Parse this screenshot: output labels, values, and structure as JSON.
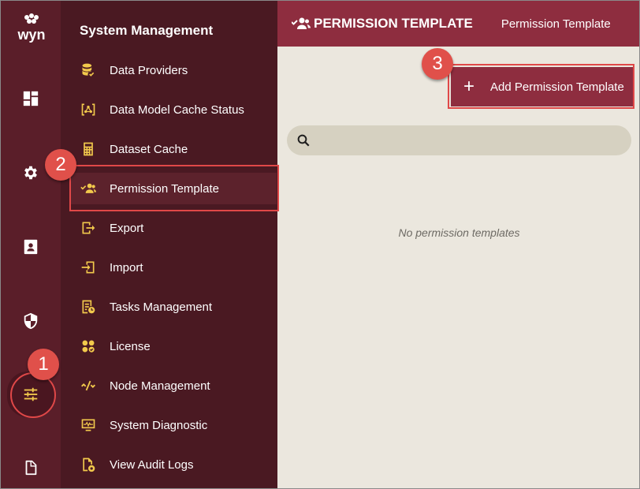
{
  "app": {
    "logo_text": "wyn"
  },
  "rail": {
    "items": [
      {
        "name": "dashboard",
        "icon": "dashboard-icon"
      },
      {
        "name": "settings",
        "icon": "gear-icon"
      },
      {
        "name": "contacts",
        "icon": "contact-card-icon"
      },
      {
        "name": "security",
        "icon": "shield-icon"
      },
      {
        "name": "system-management",
        "icon": "sliders-icon",
        "active": true
      },
      {
        "name": "documents",
        "icon": "document-icon"
      }
    ]
  },
  "menu": {
    "title": "System Management",
    "items": [
      {
        "label": "Data Providers",
        "icon": "database-check-icon"
      },
      {
        "label": "Data Model Cache Status",
        "icon": "model-cache-icon"
      },
      {
        "label": "Dataset Cache",
        "icon": "calculator-icon"
      },
      {
        "label": "Permission Template",
        "icon": "users-check-icon",
        "selected": true
      },
      {
        "label": "Export",
        "icon": "export-icon"
      },
      {
        "label": "Import",
        "icon": "import-icon"
      },
      {
        "label": "Tasks Management",
        "icon": "tasks-icon"
      },
      {
        "label": "License",
        "icon": "license-icon"
      },
      {
        "label": "Node Management",
        "icon": "node-icon"
      },
      {
        "label": "System Diagnostic",
        "icon": "monitor-pulse-icon"
      },
      {
        "label": "View Audit Logs",
        "icon": "audit-log-icon"
      }
    ]
  },
  "header": {
    "title": "PERMISSION TEMPLATE",
    "tab": "Permission Template"
  },
  "toolbar": {
    "add_label": "Add Permission Template",
    "add_icon": "+"
  },
  "search": {
    "placeholder": "",
    "value": ""
  },
  "main": {
    "empty_text": "No permission templates"
  },
  "annotations": [
    {
      "number": "1"
    },
    {
      "number": "2"
    },
    {
      "number": "3"
    }
  ],
  "colors": {
    "rail_bg": "#5a1e29",
    "menu_bg": "#4a1922",
    "header_bg": "#8e2d3f",
    "accent_icon": "#f2c94c",
    "content_bg": "#ebe7de",
    "callout": "#e0504a"
  }
}
